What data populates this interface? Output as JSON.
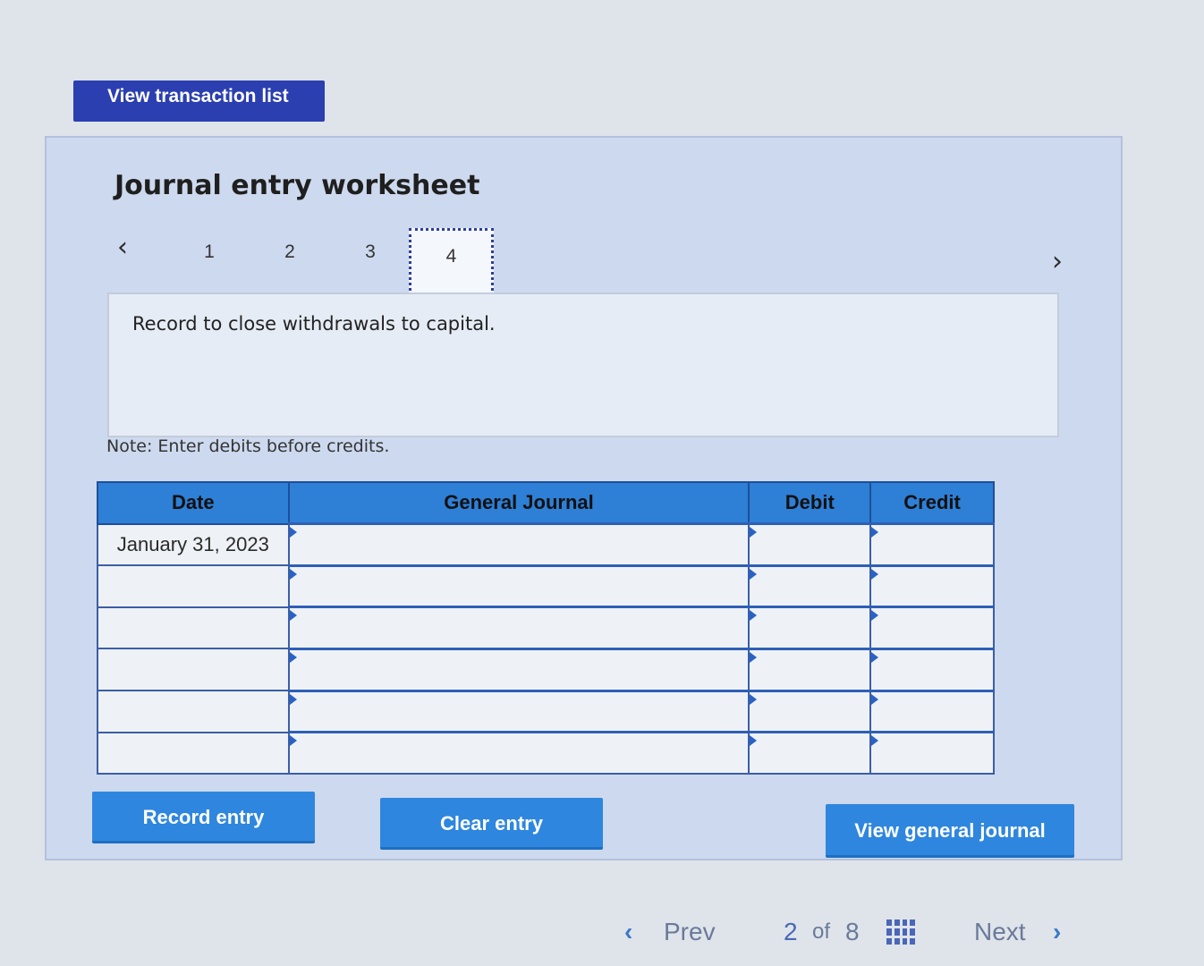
{
  "top_button": {
    "label": "View transaction list"
  },
  "worksheet": {
    "title": "Journal entry worksheet",
    "tabs": [
      "1",
      "2",
      "3",
      "4"
    ],
    "active_tab": "4",
    "prev_icon": "chevron-left-icon",
    "next_icon": "chevron-right-icon",
    "instruction": "Record to close withdrawals to capital.",
    "note": "Note: Enter debits before credits."
  },
  "table": {
    "headers": [
      "Date",
      "General Journal",
      "Debit",
      "Credit"
    ],
    "rows": [
      {
        "date": "January 31, 2023",
        "account": "",
        "debit": "",
        "credit": ""
      },
      {
        "date": "",
        "account": "",
        "debit": "",
        "credit": ""
      },
      {
        "date": "",
        "account": "",
        "debit": "",
        "credit": ""
      },
      {
        "date": "",
        "account": "",
        "debit": "",
        "credit": ""
      },
      {
        "date": "",
        "account": "",
        "debit": "",
        "credit": ""
      },
      {
        "date": "",
        "account": "",
        "debit": "",
        "credit": ""
      }
    ]
  },
  "actions": {
    "record": "Record entry",
    "clear": "Clear entry",
    "view_journal": "View general journal"
  },
  "pagination": {
    "prev": "Prev",
    "current": "2",
    "of": "of",
    "total": "8",
    "next": "Next"
  },
  "colors": {
    "header_blue": "#2e7fd6",
    "button_blue": "#2e86de",
    "top_button": "#2b3fb0"
  }
}
